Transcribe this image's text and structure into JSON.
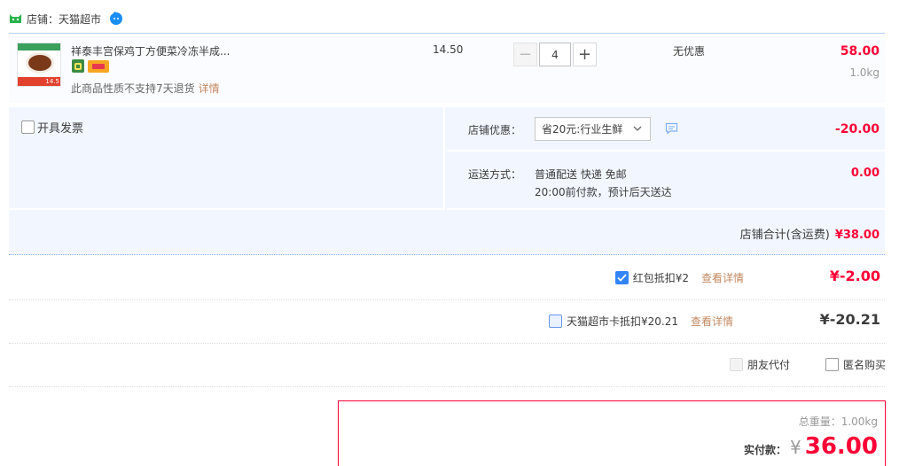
{
  "shop": {
    "label": "店铺：天猫超市"
  },
  "item": {
    "title": "祥泰丰宫保鸡丁方便菜冷冻半成...",
    "thumb_price": "14.5",
    "note": "此商品性质不支持7天退货",
    "note_link": "详情",
    "unit_price": "14.50",
    "quantity": "4",
    "promo": "无优惠",
    "subtotal": "58.00",
    "weight": "1.0kg"
  },
  "options": {
    "invoice_label": "开具发票",
    "shop_discount_label": "店铺优惠：",
    "shop_discount_select": "省20元:行业生鲜",
    "shop_discount_amount": "-20.00",
    "shipping_label": "运送方式：",
    "shipping_line1": "普通配送 快递 免邮",
    "shipping_line2": "20:00前付款，预计后天送达",
    "shipping_fee": "0.00",
    "shop_total_label": "店铺合计(含运费)",
    "shop_total_value": "¥38.00"
  },
  "deductions": {
    "redpacket_label": "红包抵扣¥2",
    "redpacket_link": "查看详情",
    "redpacket_amount": "¥-2.00",
    "redpacket_checked": true,
    "card_label": "天猫超市卡抵扣¥20.21",
    "card_link": "查看详情",
    "card_amount": "¥-20.21",
    "card_checked": false,
    "friend_pay_label": "朋友代付",
    "anonymous_label": "匿名购买"
  },
  "summary": {
    "total_weight": "总重量：1.00kg",
    "paid_label": "实付款：",
    "currency": "¥",
    "paid_amount": "36.00"
  },
  "colors": {
    "accent": "#ff0036",
    "link": "#c2875f",
    "row_bg": "#f2f7ff",
    "check_blue": "#3385ff"
  }
}
